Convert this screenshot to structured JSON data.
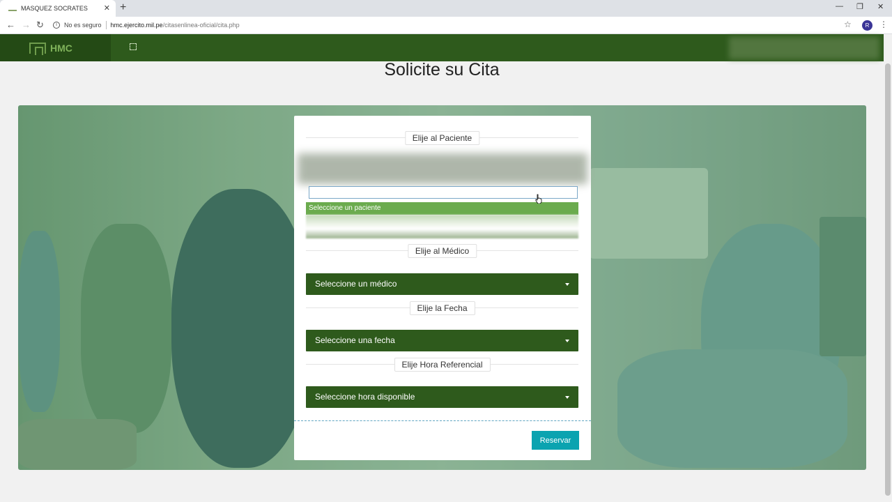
{
  "browser": {
    "tab_title": "MASQUEZ SOCRATES",
    "tab_close": "✕",
    "new_tab": "+",
    "insecure_label": "No es seguro",
    "url_host": "hmc.ejercito.mil.pe",
    "url_path": "/citasenlinea-oficial/cita.php",
    "profile_initial": "R",
    "window_controls": {
      "minimize": "—",
      "restore": "❐",
      "close": "✕"
    }
  },
  "header": {
    "brand": "HMC"
  },
  "page": {
    "title": "Solicite su Cita"
  },
  "form": {
    "patient_label": "Elije al Paciente",
    "patient_search_value": "",
    "patient_option_highlight": "Seleccione un paciente",
    "doctor_label": "Elije al Médico",
    "doctor_select": "Seleccione un médico",
    "date_label": "Elije la Fecha",
    "date_select": "Seleccione una fecha",
    "hour_label": "Elije Hora Referencial",
    "hour_select": "Seleccione hora disponible",
    "submit": "Reservar"
  },
  "colors": {
    "header_green": "#2e5a1c",
    "select_green": "#2e5a1c",
    "highlight_green": "#6bab4e",
    "reserve_teal": "#0ba3b0"
  }
}
